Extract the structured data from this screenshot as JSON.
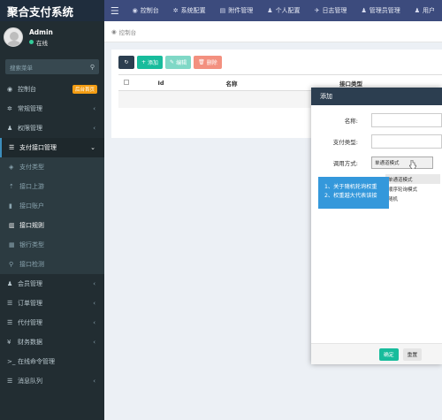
{
  "app": {
    "title": "聚合支付系统"
  },
  "topnav": [
    {
      "icon": "dashboard-icon",
      "label": "控制台"
    },
    {
      "icon": "gear-icon",
      "label": "系统配置"
    },
    {
      "icon": "file-icon",
      "label": "附件管理"
    },
    {
      "icon": "user-icon",
      "label": "个人配置"
    },
    {
      "icon": "log-icon",
      "label": "日志管理"
    },
    {
      "icon": "admin-icon",
      "label": "管理员管理"
    },
    {
      "icon": "users-icon",
      "label": "用户"
    }
  ],
  "user": {
    "name": "Admin",
    "status": "在线"
  },
  "search": {
    "placeholder": "搜索菜单"
  },
  "sidebar": {
    "dashboard": {
      "label": "控制台",
      "badge": "后台首页"
    },
    "items": [
      {
        "label": "常规管理"
      },
      {
        "label": "权限管理"
      },
      {
        "label": "支付接口管理"
      }
    ],
    "sub": [
      {
        "label": "支付类型"
      },
      {
        "label": "接口上游"
      },
      {
        "label": "接口账户"
      },
      {
        "label": "接口规则"
      },
      {
        "label": "银行类型"
      },
      {
        "label": "接口检测"
      }
    ],
    "items2": [
      {
        "label": "会员管理"
      },
      {
        "label": "订单管理"
      },
      {
        "label": "代付管理"
      },
      {
        "label": "财务数据"
      },
      {
        "label": "在线命令管理"
      },
      {
        "label": "消息队列"
      }
    ]
  },
  "breadcrumb": {
    "label": "控制台"
  },
  "toolbar": {
    "add": "添加",
    "edit": "编辑",
    "delete": "删除"
  },
  "table": {
    "columns": [
      "Id",
      "名称",
      "接口类型"
    ]
  },
  "modal": {
    "title": "添加",
    "fields": {
      "name": "名称:",
      "pay_type": "支付类型:",
      "call_mode": "调用方式:"
    },
    "call_mode_value": "单通道模式",
    "options": [
      "单通道模式",
      "顺序轮询模式",
      "随机"
    ],
    "alert_lines": [
      "1、关于随机轮询权重",
      "2、权重越大代表该接"
    ],
    "ok": "确定",
    "reset": "重置"
  },
  "colors": {
    "sidebar_bg": "#222d32",
    "topbar_bg": "#3c4b7d",
    "accent": "#18bc9c",
    "modal_head": "#2c3e50"
  }
}
